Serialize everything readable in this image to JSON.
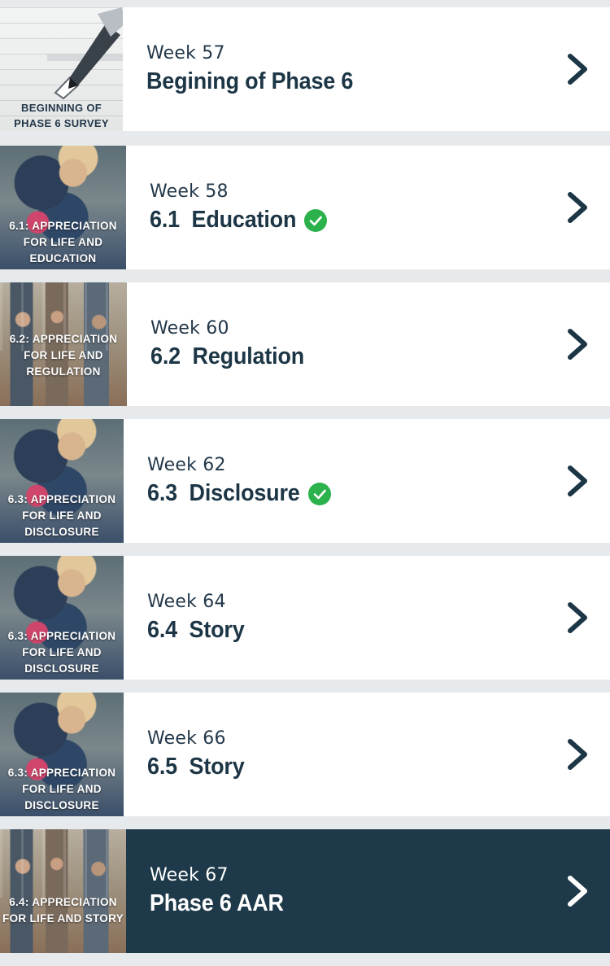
{
  "lessons": [
    {
      "week": "Week 57",
      "title": "Begining of Phase 6",
      "thumb_caption": "BEGINNING OF PHASE 6 SURVEY",
      "thumb": "survey",
      "completed": false,
      "active": false
    },
    {
      "week": "Week 58",
      "title": "6.1  Education",
      "thumb_caption": "6.1: APPRECIATION FOR LIFE AND EDUCATION",
      "thumb": "hug",
      "completed": true,
      "active": false
    },
    {
      "week": "Week 60",
      "title": "6.2  Regulation",
      "thumb_caption": "6.2: APPRECIATION FOR LIFE AND REGULATION",
      "thumb": "people",
      "completed": false,
      "active": false
    },
    {
      "week": "Week 62",
      "title": "6.3  Disclosure",
      "thumb_caption": "6.3: APPRECIATION FOR LIFE AND DISCLOSURE",
      "thumb": "hug",
      "completed": true,
      "active": false
    },
    {
      "week": "Week 64",
      "title": "6.4  Story",
      "thumb_caption": "6.3: APPRECIATION FOR LIFE AND DISCLOSURE",
      "thumb": "hug",
      "completed": false,
      "active": false
    },
    {
      "week": "Week 66",
      "title": "6.5  Story",
      "thumb_caption": "6.3: APPRECIATION FOR LIFE AND DISCLOSURE",
      "thumb": "hug",
      "completed": false,
      "active": false
    },
    {
      "week": "Week 67",
      "title": "Phase 6 AAR",
      "thumb_caption": "6.4: APPRECIATION FOR LIFE AND STORY",
      "thumb": "people",
      "completed": false,
      "active": true
    }
  ],
  "icons": {
    "chevron": "chevron-right-icon",
    "check": "check-circle-icon"
  },
  "colors": {
    "accent_dark": "#1e3a4a",
    "check_green": "#2bb24c",
    "divider": "#e6eaec"
  }
}
